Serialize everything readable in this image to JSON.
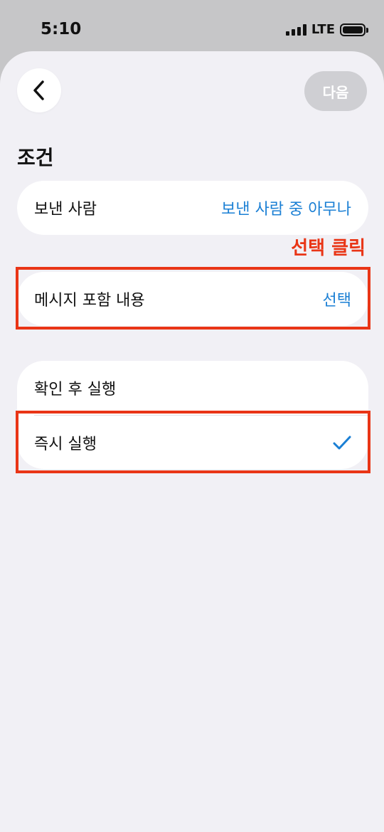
{
  "status": {
    "time": "5:10",
    "network": "LTE"
  },
  "nav": {
    "next_label": "다음"
  },
  "section": {
    "title": "조건"
  },
  "sender": {
    "label": "보낸 사람",
    "value": "보낸 사람 중 아무나"
  },
  "annotation": {
    "text": "선택 클릭"
  },
  "message": {
    "label": "메시지 포함 내용",
    "value": "선택"
  },
  "run_options": [
    {
      "label": "확인 후 실행",
      "selected": false
    },
    {
      "label": "즉시 실행",
      "selected": true
    }
  ],
  "colors": {
    "accent": "#1a7fd4",
    "highlight": "#e93516",
    "background": "#f1f0f5"
  }
}
